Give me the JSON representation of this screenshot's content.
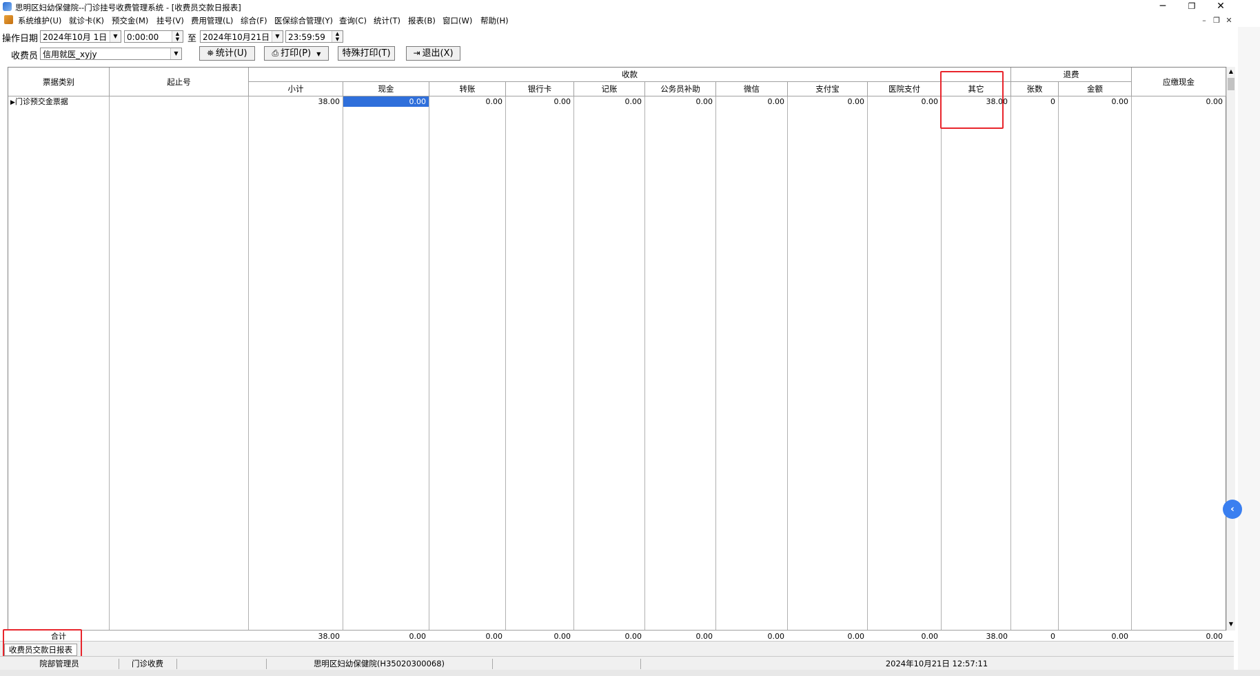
{
  "window": {
    "title": "思明区妇幼保健院--门诊挂号收费管理系统 - [收费员交款日报表]",
    "controls": [
      "─",
      "❐",
      "✕"
    ],
    "mdi_controls": [
      "–",
      "❐",
      "✕"
    ]
  },
  "menu": [
    "系统维护(U)",
    "就诊卡(K)",
    "预交金(M)",
    "挂号(V)",
    "费用管理(L)",
    "综合(F)",
    "医保综合管理(Y)",
    "查询(C)",
    "统计(T)",
    "报表(B)",
    "窗口(W)",
    "帮助(H)"
  ],
  "toolbar": {
    "date_label": "操作日期",
    "date_from": "2024年10月 1日",
    "time_from": "0:00:00",
    "to_label": "至",
    "date_to": "2024年10月21日",
    "time_to": "23:59:59",
    "cashier_label": "收费员",
    "cashier_value": "信用就医_xyjy",
    "btn_stat": "统计(U)",
    "btn_print": "打印(P)",
    "btn_special_print": "特殊打印(T)",
    "btn_exit": "退出(X)"
  },
  "grid": {
    "group_receipt": "收款",
    "group_refund": "退费",
    "col_type": "票据类别",
    "col_start_no": "起止号",
    "col_payable_cash": "应缴现金",
    "sub_receipt": [
      "小计",
      "现金",
      "转账",
      "银行卡",
      "记账",
      "公务员补助",
      "微信",
      "支付宝",
      "医院支付",
      "其它"
    ],
    "sub_refund": [
      "张数",
      "金额"
    ],
    "row": {
      "type": "门诊预交金票据",
      "start_no": "",
      "values": [
        "38.00",
        "0.00",
        "0.00",
        "0.00",
        "0.00",
        "0.00",
        "0.00",
        "0.00",
        "0.00",
        "38.00",
        "0",
        "0.00",
        "0.00"
      ]
    },
    "total": {
      "label": "合计",
      "values": [
        "38.00",
        "0.00",
        "0.00",
        "0.00",
        "0.00",
        "0.00",
        "0.00",
        "0.00",
        "0.00",
        "38.00",
        "0",
        "0.00",
        "0.00"
      ]
    }
  },
  "tab": {
    "label": "收费员交款日报表"
  },
  "status": {
    "user": "院部管理员",
    "dept": "门诊收费",
    "hospital": "思明区妇幼保健院(H35020300068)",
    "datetime": "2024年10月21日 12:57:11"
  },
  "colors": {
    "highlight": "#e8242b",
    "selection": "#2f6fdb"
  }
}
